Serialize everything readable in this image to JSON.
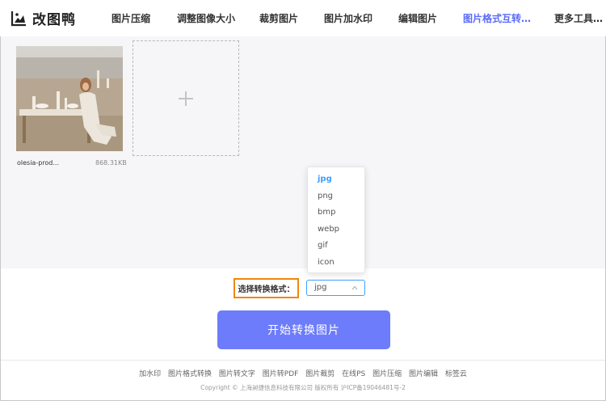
{
  "header": {
    "logo_text": "改图鸭",
    "nav": [
      {
        "label": "图片压缩"
      },
      {
        "label": "调整图像大小"
      },
      {
        "label": "裁剪图片"
      },
      {
        "label": "图片加水印"
      },
      {
        "label": "编辑图片"
      },
      {
        "label": "图片格式互转…"
      },
      {
        "label": "更多工具…"
      }
    ],
    "active_index": 5
  },
  "upload": {
    "file_name": "olesia-prod...",
    "file_size": "868.31KB"
  },
  "dropdown": {
    "options": [
      "jpg",
      "png",
      "bmp",
      "webp",
      "gif",
      "icon"
    ],
    "selected": "jpg"
  },
  "format": {
    "label": "选择转换格式：",
    "value": "jpg"
  },
  "start_button": "开始转换图片",
  "footer": {
    "links": [
      "加水印",
      "图片格式转换",
      "图片转文字",
      "图片转PDF",
      "图片裁剪",
      "在线PS",
      "图片压缩",
      "图片编辑",
      "标签云"
    ],
    "copyright": "Copyright © 上海昶捷信息科技有限公司 版权所有 沪ICP备19046481号-2"
  },
  "colors": {
    "accent": "#6c7cfa",
    "nav_active": "#5b6cf7",
    "select_border": "#409eff",
    "highlight_border": "#f0870a"
  }
}
